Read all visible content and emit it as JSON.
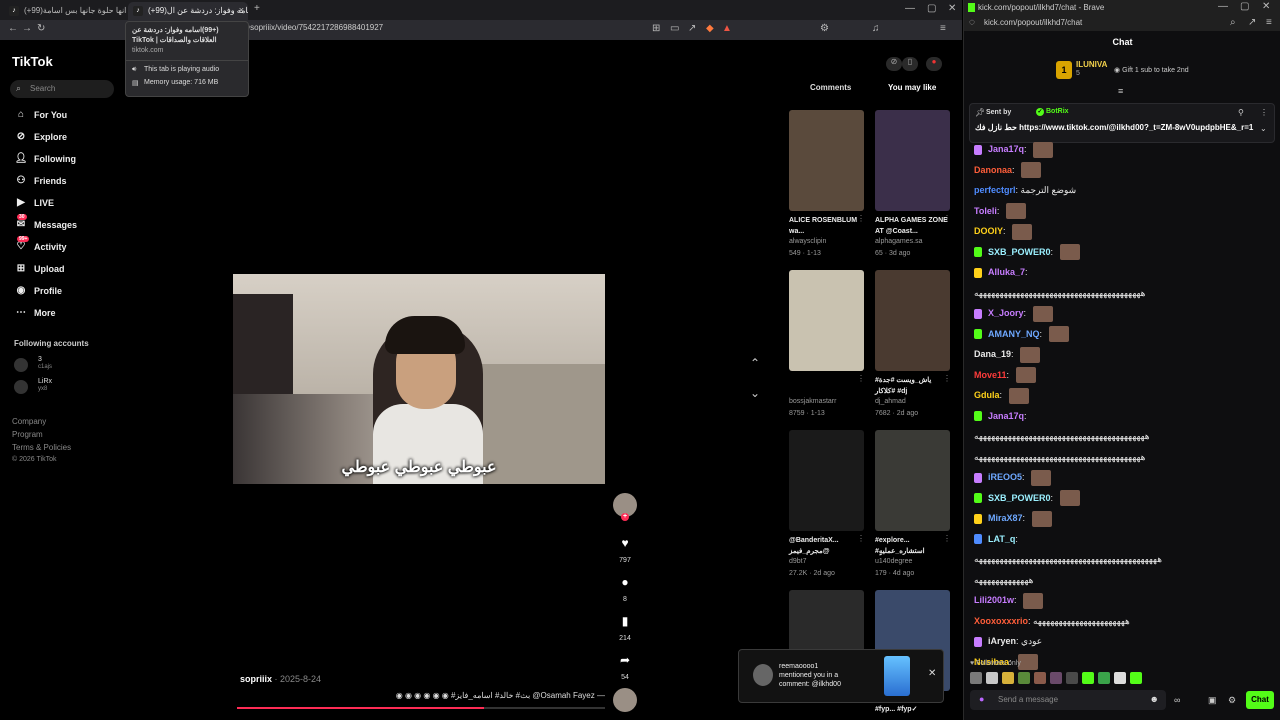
{
  "left_browser": {
    "tabs": [
      {
        "label": "(+99)والله انها حلوة جانها بس اسامة ..."
      },
      {
        "label": "(+99)اسامه وفواز: دردشة عن ال"
      }
    ],
    "url": "@sopriiix/video/7542217286988401927",
    "tooltip": {
      "title": "(+99)اسامه وفواز: دردشة عن العلاقات والصداقات | TikTok",
      "domain": "tiktok.com",
      "audio": "This tab is playing audio",
      "memory": "Memory usage: 716 MB"
    }
  },
  "tiktok": {
    "logo": "TikTok",
    "search_placeholder": "Search",
    "nav": [
      {
        "label": "For You",
        "icon": "home-icon"
      },
      {
        "label": "Explore",
        "icon": "compass-icon"
      },
      {
        "label": "Following",
        "icon": "following-icon"
      },
      {
        "label": "Friends",
        "icon": "friends-icon"
      },
      {
        "label": "LIVE",
        "icon": "live-icon"
      },
      {
        "label": "Messages",
        "icon": "messages-icon",
        "badge": "30"
      },
      {
        "label": "Activity",
        "icon": "activity-icon",
        "badge": "99+"
      },
      {
        "label": "Upload",
        "icon": "upload-icon"
      },
      {
        "label": "Profile",
        "icon": "profile-icon"
      },
      {
        "label": "More",
        "icon": "more-icon"
      }
    ],
    "following_header": "Following accounts",
    "accounts": [
      {
        "name": "3",
        "handle": "c1ajs"
      },
      {
        "name": "LiRx",
        "handle": "yx8"
      }
    ],
    "footer": [
      "Company",
      "Program",
      "Terms & Policies",
      "© 2026 TikTok"
    ],
    "video": {
      "caption": "عبوطي عبوطي عبوطي",
      "author": "sopriiix",
      "date": "2025-8-24",
      "description": "— Osamah Fayez@ بث# خالد# اسامه_فايز# ◉ ◉ ◉ ◉ ◉ ◉",
      "progress": 0.67
    },
    "actions": {
      "likes": "797",
      "comments": "8",
      "saves": "214",
      "shares": "54"
    },
    "tabs": {
      "comments": "Comments",
      "you_may_like": "You may like"
    },
    "feed": [
      {
        "title": "ALICE ROSENBLUM wa...",
        "user": "alwaysclipin",
        "stats": "549 · 1-13",
        "bg": "#5a4a3c"
      },
      {
        "title": "ALPHA GAMES ZONE AT @Coast...",
        "user": "alphagames.sa",
        "stats": "65 · 3d ago",
        "bg": "#3b2f4a"
      },
      {
        "title": "",
        "user": "bossjakmastarr",
        "stats": "8759 · 1-13",
        "bg": "#c9c2b0"
      },
      {
        "title": "#ياش_ويست #جدة #كلاكار #dj",
        "user": "dj_ahmad",
        "stats": "7682 · 2d ago",
        "bg": "#4a3a30"
      },
      {
        "title": "@BanderitaX... مجرم_فيمز@",
        "user": "d9bt7",
        "stats": "27.2K · 2d ago",
        "bg": "#1a1a1a"
      },
      {
        "title": "#explore... #استشاره_عمليهٍ",
        "user": "u140degree",
        "stats": "179 · 4d ago",
        "bg": "#3a3a36"
      },
      {
        "title": "",
        "user": "",
        "stats": "",
        "bg": "#2a2a2a"
      },
      {
        "title": "#fyp... #fyp✓",
        "user": "",
        "stats": "",
        "bg": "#3a4a6a"
      }
    ],
    "notification": {
      "user": "reemaoooo1",
      "text": "mentioned you in a comment: @ilkhd00"
    }
  },
  "kick": {
    "window_title": "kick.com/popout/ilkhd7/chat - Brave",
    "url": "kick.com/popout/ilkhd7/chat",
    "header": "Chat",
    "gifter": {
      "name": "ILUNIVA",
      "count": "5",
      "text": "Gift 1 sub to take 2nd"
    },
    "pinned": {
      "sent_by": "Sent by",
      "bot": "BotRix",
      "text": "حط نازل فك https://www.tiktok.com/@ilkhd00?_t=ZM-8wV0updpbHE&_r=1"
    },
    "messages": [
      {
        "user": "Jana17q",
        "color": "#c77dff",
        "text": "",
        "emote": true,
        "indent": true
      },
      {
        "user": "Danonaa",
        "color": "#ff5e3a",
        "text": "",
        "emote": true
      },
      {
        "user": "perfectgrl",
        "color": "#4f8cff",
        "text": "شوضع الترجمة"
      },
      {
        "user": "Toleli",
        "color": "#c77dff",
        "text": "",
        "emote": true
      },
      {
        "user": "DOOIY",
        "color": "#ffd11a",
        "text": "",
        "emote": true
      },
      {
        "user": "SXB_POWER0",
        "color": "#9bf0ff",
        "text": "",
        "emote": true,
        "indent": true
      },
      {
        "user": "Alluka_7",
        "color": "#c77dff",
        "text": "",
        "indent": true
      },
      {
        "user": "",
        "color": "#ffffff",
        "text": "ههههههههههههههههههههههههههههههههههههههههه"
      },
      {
        "user": "X_Joory",
        "color": "#c77dff",
        "text": "",
        "emote": true,
        "indent": true
      },
      {
        "user": "AMANY_NQ",
        "color": "#6ea8ff",
        "text": "",
        "emote": true,
        "indent": true
      },
      {
        "user": "Dana_19",
        "color": "#e9e9e9",
        "text": "",
        "emote": true
      },
      {
        "user": "Move11",
        "color": "#ff3b3b",
        "text": "",
        "emote": true
      },
      {
        "user": "Gdula",
        "color": "#ffd11a",
        "text": "",
        "emote": true
      },
      {
        "user": "Jana17q",
        "color": "#c77dff",
        "text": "",
        "indent": true
      },
      {
        "user": "",
        "color": "#ffffff",
        "text": "هههههههههههههههههههههههههههههههههههههههههه"
      },
      {
        "user": "",
        "color": "#ffffff",
        "text": "ههههههههههههههههههههههههههههههههههههههههه"
      },
      {
        "user": "iREOO5",
        "color": "#6ea8ff",
        "text": "",
        "emote": true,
        "indent": true
      },
      {
        "user": "SXB_POWER0",
        "color": "#9bf0ff",
        "text": "",
        "emote": true,
        "indent": true
      },
      {
        "user": "MiraX87",
        "color": "#6ea8ff",
        "text": "",
        "emote": true,
        "indent": true
      },
      {
        "user": "LAT_q",
        "color": "#9bf0ff",
        "text": "",
        "indent": true
      },
      {
        "user": "",
        "color": "#ffffff",
        "text": "ههههههههههههههههههههههههههههههههههههههههههههه"
      },
      {
        "user": "",
        "color": "#ffffff",
        "text": "هههههههههههههه"
      },
      {
        "user": "Lili2001w",
        "color": "#c77dff",
        "text": "",
        "emote": true
      },
      {
        "user": "Xooxoxxxrio",
        "color": "#ff5e3a",
        "text": "ههههههههههههههههههههههه"
      },
      {
        "user": "iAryen",
        "color": "#e9e9e9",
        "text": "عودي",
        "indent": true
      },
      {
        "user": "Nusibaa",
        "color": "#ffd11a",
        "text": "",
        "emote": true
      }
    ],
    "followers_only": "Followers only",
    "input_placeholder": "Send a message",
    "chat_button": "Chat",
    "accent": "#53fc18"
  }
}
